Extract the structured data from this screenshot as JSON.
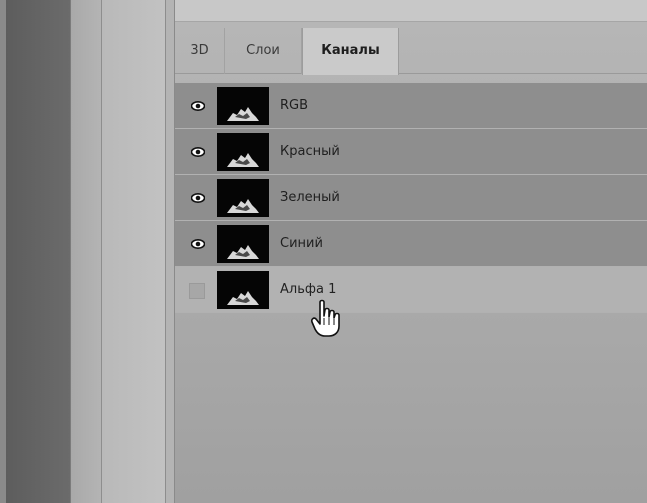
{
  "tabs": [
    {
      "label": "3D",
      "active": false
    },
    {
      "label": "Слои",
      "active": false
    },
    {
      "label": "Каналы",
      "active": true
    }
  ],
  "channels": [
    {
      "name": "RGB",
      "visible": true,
      "icon": "eye-icon"
    },
    {
      "name": "Красный",
      "visible": true,
      "icon": "eye-icon"
    },
    {
      "name": "Зеленый",
      "visible": true,
      "icon": "eye-icon"
    },
    {
      "name": "Синий",
      "visible": true,
      "icon": "eye-icon"
    },
    {
      "name": "Альфа 1",
      "visible": false,
      "icon": "visibility-checkbox"
    }
  ],
  "cursor": {
    "icon": "hand-pointer-icon"
  },
  "colors": {
    "panel": "#a9a9a9",
    "row_visible": "#8e8e8e",
    "active_tab": "#cacaca"
  }
}
